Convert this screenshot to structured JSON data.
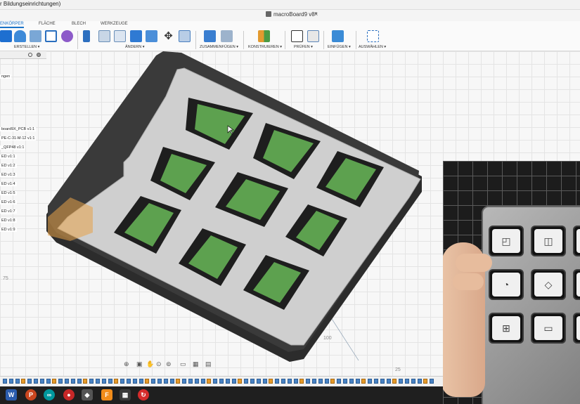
{
  "window": {
    "title_fragment": "r Bildungseinrichtungen)",
    "document_tab": "macroBoard9 v8*",
    "close_glyph": "×"
  },
  "ribbon": {
    "tabs": [
      {
        "label": "ENKÖRPER",
        "active": true
      },
      {
        "label": "FLÄCHE",
        "active": false
      },
      {
        "label": "BLECH",
        "active": false
      },
      {
        "label": "WERKZEUGE",
        "active": false
      }
    ],
    "groups": [
      {
        "label": "ERSTELLEN ▾"
      },
      {
        "label": "ÄNDERN ▾"
      },
      {
        "label": "ZUSAMMENFÜGEN ▾"
      },
      {
        "label": "KONSTRUIEREN ▾"
      },
      {
        "label": "PRÜFEN ▾"
      },
      {
        "label": "EINFÜGEN ▾"
      },
      {
        "label": "AUSWÄHLEN ▾"
      }
    ],
    "accent_color": "#1a73c9"
  },
  "browser": {
    "items": [
      "ngen",
      "board9X_PCB v1:1",
      "PE-C-31-M-12 v1:1",
      "_QFP48 v1:1",
      "ED v1:1",
      "ED v1:2",
      "ED v1:3",
      "ED v1:4",
      "ED v1:5",
      "ED v1:6",
      "ED v1:7",
      "ED v1:8",
      "ED v1:9"
    ]
  },
  "viewport": {
    "axis_labels": [
      "100",
      "75",
      "25"
    ],
    "model_colors": {
      "frame": "#3a3a3a",
      "plate": "#cfcfcf",
      "key": "#5da14f"
    }
  },
  "overlay_photo": {
    "key_icons": [
      "◰",
      "◫",
      "◩",
      "◔",
      "◇",
      "▢",
      "⊞",
      "▭",
      "▭"
    ]
  }
}
